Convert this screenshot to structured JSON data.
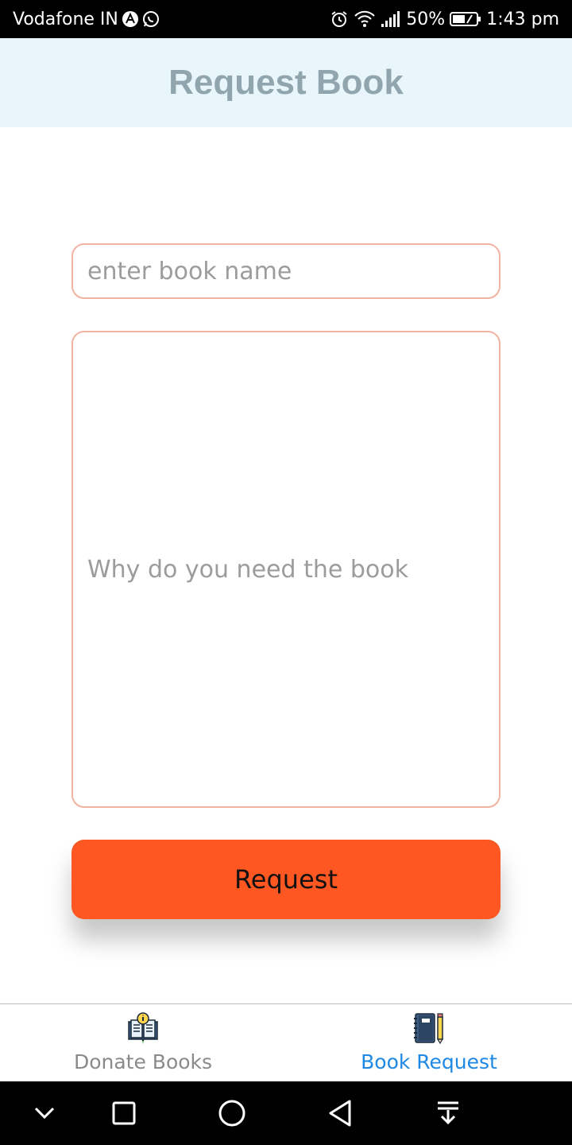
{
  "status_bar": {
    "carrier": "Vodafone IN",
    "battery": "50%",
    "time": "1:43 pm",
    "icons": [
      "a-circle-icon",
      "whatsapp-icon",
      "alarm-icon",
      "wifi-icon",
      "signal-icon",
      "battery-icon"
    ]
  },
  "header": {
    "title": "Request Book",
    "background": "#e8f5fb",
    "title_color": "#91a5ae"
  },
  "form": {
    "book_name_placeholder": "enter book name",
    "reason_placeholder": "Why do you need the book",
    "border_color": "#f2b3a1",
    "submit_label": "Request",
    "submit_color": "#ff5722"
  },
  "tabs": [
    {
      "label": "Donate Books",
      "icon": "book-info-icon",
      "active": false
    },
    {
      "label": "Book Request",
      "icon": "notebook-pencil-icon",
      "active": true
    }
  ],
  "tab_colors": {
    "active": "#1e88e5",
    "inactive": "#8a8a8a"
  },
  "nav_bar": {
    "buttons": [
      "chevron-down-icon",
      "recents-square-icon",
      "home-circle-icon",
      "back-triangle-icon",
      "notification-pull-icon"
    ]
  }
}
